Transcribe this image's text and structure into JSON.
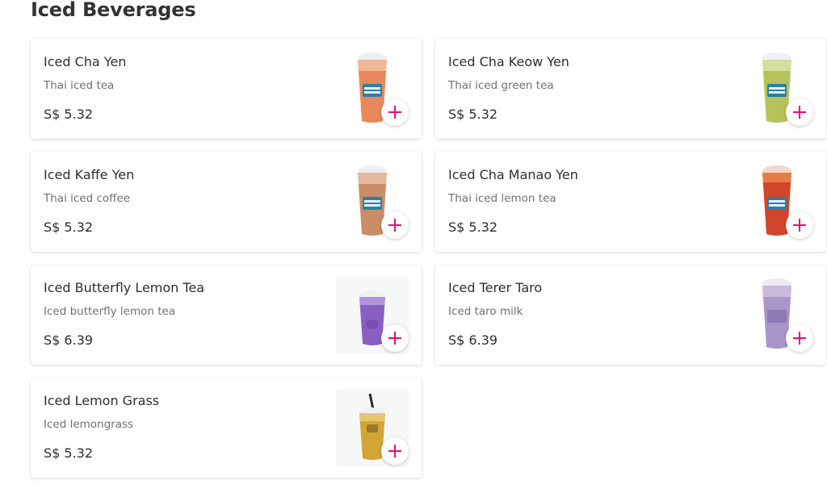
{
  "section": {
    "title": "Iced Beverages"
  },
  "accent_color": "#e2126b",
  "items": [
    {
      "name": "Iced Cha Yen",
      "desc": "Thai iced tea",
      "price": "S$ 5.32",
      "drink_color": "#e8875a",
      "icon": "plus-icon"
    },
    {
      "name": "Iced Cha Keow Yen",
      "desc": "Thai iced green tea",
      "price": "S$ 5.32",
      "drink_color": "#b5c35a",
      "icon": "plus-icon"
    },
    {
      "name": "Iced Kaffe Yen",
      "desc": "Thai iced coffee",
      "price": "S$ 5.32",
      "drink_color": "#c98d67",
      "icon": "plus-icon"
    },
    {
      "name": "Iced Cha Manao Yen",
      "desc": "Thai iced lemon tea",
      "price": "S$ 5.32",
      "drink_color": "#d2452a",
      "icon": "plus-icon"
    },
    {
      "name": "Iced Butterfly Lemon Tea",
      "desc": "Iced butterfly lemon tea",
      "price": "S$ 6.39",
      "drink_color": "#8a5fc4",
      "icon": "plus-icon"
    },
    {
      "name": "Iced Terer Taro",
      "desc": "Iced taro milk",
      "price": "S$ 6.39",
      "drink_color": "#a996c8",
      "icon": "plus-icon"
    },
    {
      "name": "Iced Lemon Grass",
      "desc": "Iced lemongrass",
      "price": "S$ 5.32",
      "drink_color": "#d2a634",
      "icon": "plus-icon"
    }
  ]
}
